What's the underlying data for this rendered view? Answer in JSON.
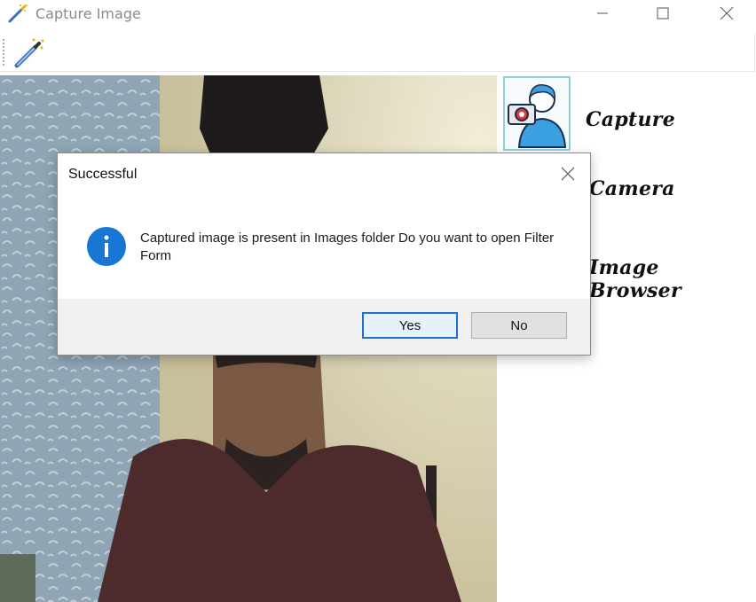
{
  "window": {
    "title": "Capture Image",
    "icon": "magic-wand-icon"
  },
  "toolbar": {
    "tool_icon": "magic-wand-icon"
  },
  "sidebar": {
    "items": [
      {
        "label": "Capture",
        "icon": "camera-person-icon"
      },
      {
        "label": "Camera"
      },
      {
        "label": "Image Browser"
      }
    ]
  },
  "dialog": {
    "title": "Successful",
    "message": "Captured image is present in Images folder Do you want to open Filter Form",
    "icon": "info-icon",
    "buttons": {
      "yes": "Yes",
      "no": "No"
    }
  },
  "colors": {
    "accent": "#1f6fd1",
    "info_icon": "#1976d2",
    "thumb_border": "#8fd0df"
  }
}
